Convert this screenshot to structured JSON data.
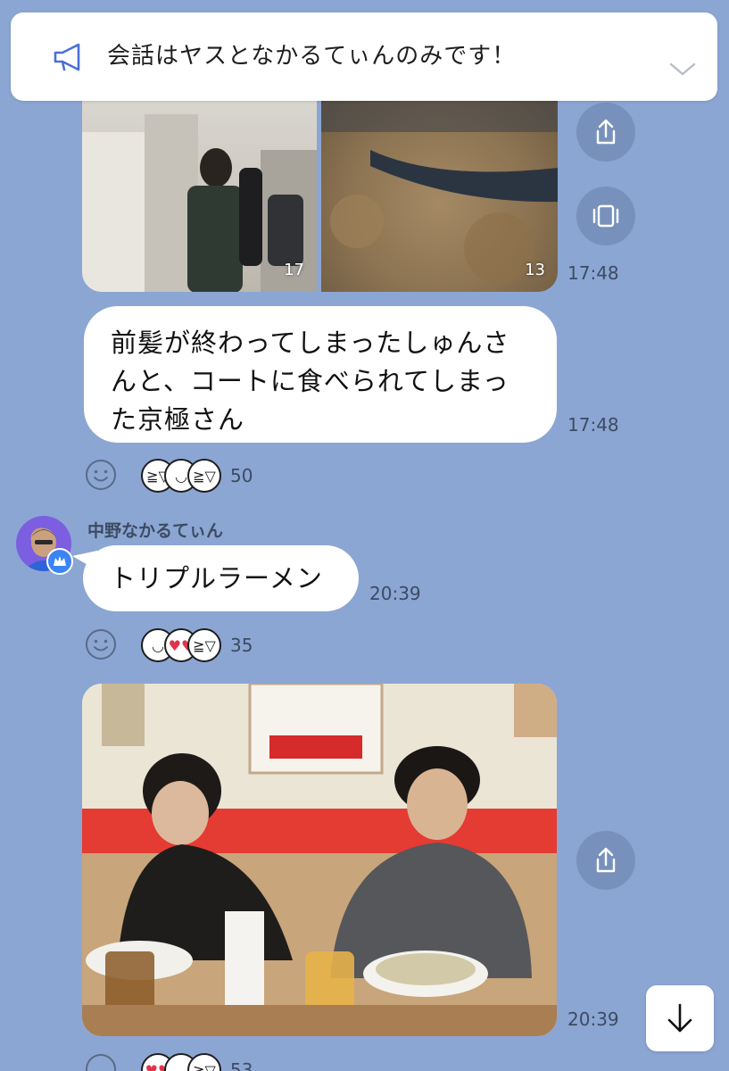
{
  "announcement": {
    "text": "会話はヤスとなかるてぃんのみです！"
  },
  "messages": {
    "photo_pair": {
      "left_count": "17",
      "right_count": "13",
      "time": "17:48"
    },
    "caption": {
      "lines": [
        "前髪が終わってしまったしゅんさ",
        "んと、コートに食べられてしまっ",
        "た京極さん"
      ],
      "time": "17:48",
      "reaction_count": "50"
    },
    "sender": {
      "name": "中野なかるてぃん"
    },
    "ramen_text": {
      "text": "トリプルラーメン",
      "time": "20:39",
      "reaction_count": "35"
    },
    "ramen_photo": {
      "time": "20:39"
    },
    "last": {
      "reaction_count": "53"
    }
  },
  "icons": {
    "announce": "megaphone-icon",
    "chevron": "chevron-down-icon",
    "share": "share-icon",
    "gallery": "gallery-icon",
    "react": "smiley-icon",
    "scroll": "arrow-down-icon"
  },
  "colors": {
    "background": "#8ba6d3",
    "bubble": "#ffffff",
    "accent": "#3a84f5"
  }
}
